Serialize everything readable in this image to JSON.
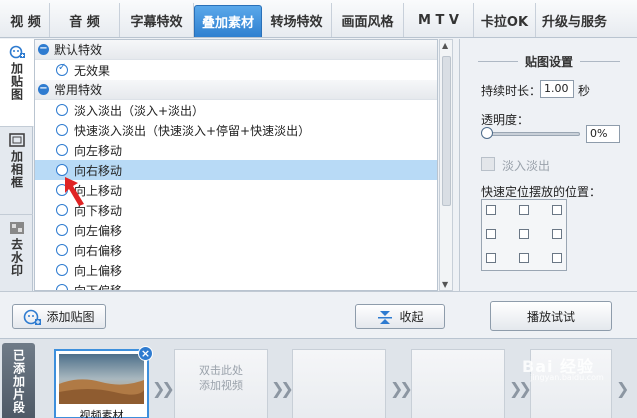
{
  "top_tabs": [
    {
      "label": "视 频",
      "active": false
    },
    {
      "label": "音 频",
      "active": false
    },
    {
      "label": "字幕特效",
      "active": false
    },
    {
      "label": "叠加素材",
      "active": true
    },
    {
      "label": "转场特效",
      "active": false
    },
    {
      "label": "画面风格",
      "active": false
    },
    {
      "label": "M T V",
      "active": false
    },
    {
      "label": "卡拉OK",
      "active": false
    },
    {
      "label": "升级与服务",
      "active": false
    }
  ],
  "side_tabs": [
    {
      "label": "加贴图",
      "icon": "sticker-add-icon",
      "active": true
    },
    {
      "label": "加相框",
      "icon": "frame-icon",
      "active": false
    },
    {
      "label": "去水印",
      "icon": "watermark-remove-icon",
      "active": false
    }
  ],
  "effects": {
    "groups": [
      {
        "label": "默认特效",
        "items": [
          {
            "label": "无效果",
            "checked": true,
            "selected": false
          }
        ]
      },
      {
        "label": "常用特效",
        "items": [
          {
            "label": "淡入淡出（淡入+淡出）",
            "checked": false,
            "selected": false
          },
          {
            "label": "快速淡入淡出（快速淡入+停留+快速淡出）",
            "checked": false,
            "selected": false
          },
          {
            "label": "向左移动",
            "checked": false,
            "selected": false
          },
          {
            "label": "向右移动",
            "checked": false,
            "selected": true
          },
          {
            "label": "向上移动",
            "checked": false,
            "selected": false
          },
          {
            "label": "向下移动",
            "checked": false,
            "selected": false
          },
          {
            "label": "向左偏移",
            "checked": false,
            "selected": false
          },
          {
            "label": "向右偏移",
            "checked": false,
            "selected": false
          },
          {
            "label": "向上偏移",
            "checked": false,
            "selected": false
          },
          {
            "label": "向下偏移",
            "checked": false,
            "selected": false
          }
        ]
      }
    ]
  },
  "settings": {
    "title": "贴图设置",
    "duration_label": "持续时长：",
    "duration_value": "1.00",
    "duration_unit": "秒",
    "opacity_label": "透明度：",
    "opacity_value": "0%",
    "fade_label": "淡入淡出",
    "position_label": "快速定位摆放的位置："
  },
  "buttons": {
    "add_sticker": "添加贴图",
    "collapse": "收起",
    "play_preview": "播放试试"
  },
  "timeline": {
    "label": "已添加片段",
    "clip_caption": "视频素材",
    "hint": "双击此处\n添加视频"
  },
  "watermark": {
    "text": "Bai 经验",
    "sub": "jingyan.baidu.com"
  },
  "colors": {
    "accent": "#2e7bd0",
    "selected_row": "#b8daf6",
    "arrow_red": "#e02424"
  }
}
